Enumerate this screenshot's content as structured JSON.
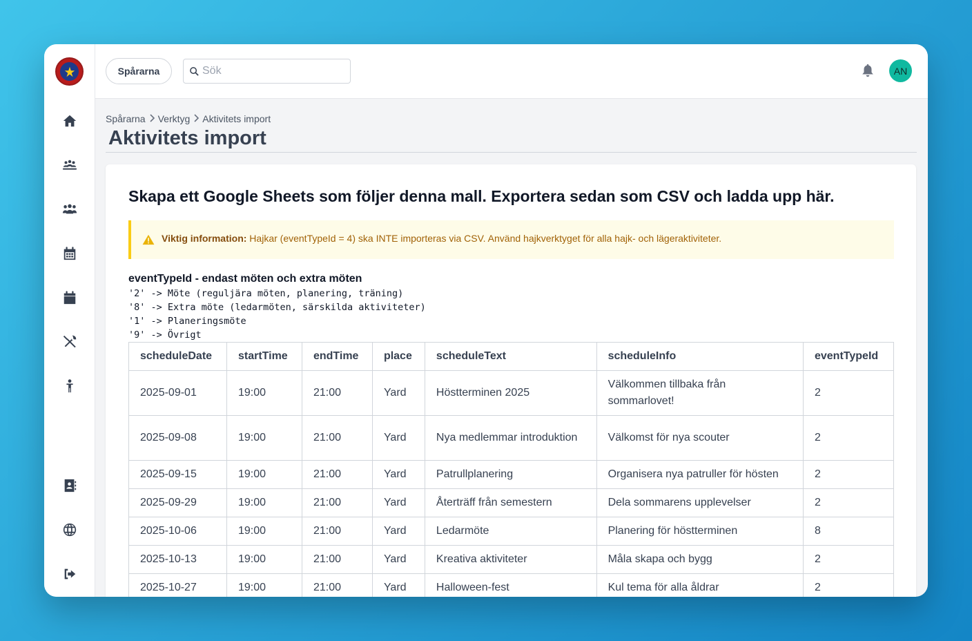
{
  "app": {
    "org_button_label": "Spårarna",
    "search_placeholder": "Sök",
    "avatar_initials": "AN",
    "colors": {
      "avatar": "#10b9a0",
      "notice_border": "#facc15",
      "notice_bg": "#fefce8"
    }
  },
  "sidebar": {
    "top_items": [
      {
        "icon": "home-icon"
      },
      {
        "icon": "group-meeting-icon"
      },
      {
        "icon": "users-icon"
      },
      {
        "icon": "calendar-grid-icon"
      },
      {
        "icon": "calendar-icon"
      },
      {
        "icon": "tools-icon"
      },
      {
        "icon": "person-icon"
      }
    ],
    "bottom_items": [
      {
        "icon": "contact-card-icon"
      },
      {
        "icon": "globe-icon"
      },
      {
        "icon": "logout-icon"
      }
    ]
  },
  "breadcrumb": [
    "Spårarna",
    "Verktyg",
    "Aktivitets import"
  ],
  "page": {
    "title": "Aktivitets import"
  },
  "card": {
    "heading": "Skapa ett Google Sheets som följer denna mall. Exportera sedan som CSV och ladda upp här.",
    "notice": {
      "label": "Viktig information:",
      "text": " Hajkar (eventTypeId = 4) ska INTE importeras via CSV. Använd hajkverktyget för alla hajk- och lägeraktiviteter."
    },
    "event_types_heading": "eventTypeId - endast möten och extra möten",
    "event_types": [
      "'2' -> Möte (reguljära möten, planering, träning)",
      "'8' -> Extra möte (ledarmöten, särskilda aktiviteter)",
      "'1' -> Planeringsmöte",
      "'9' -> Övrigt"
    ]
  },
  "table": {
    "columns": [
      "scheduleDate",
      "startTime",
      "endTime",
      "place",
      "scheduleText",
      "scheduleInfo",
      "eventTypeId"
    ],
    "rows": [
      [
        "2025-09-01",
        "19:00",
        "21:00",
        "Yard",
        "Höstterminen 2025",
        "Välkommen tillbaka från sommarlovet!",
        "2"
      ],
      [
        "2025-09-08",
        "19:00",
        "21:00",
        "Yard",
        "Nya medlemmar introduktion",
        "Välkomst för nya scouter",
        "2"
      ],
      [
        "2025-09-15",
        "19:00",
        "21:00",
        "Yard",
        "Patrullplanering",
        "Organisera nya patruller för hösten",
        "2"
      ],
      [
        "2025-09-29",
        "19:00",
        "21:00",
        "Yard",
        "Återträff från semestern",
        "Dela sommarens upplevelser",
        "2"
      ],
      [
        "2025-10-06",
        "19:00",
        "21:00",
        "Yard",
        "Ledarmöte",
        "Planering för höstterminen",
        "8"
      ],
      [
        "2025-10-13",
        "19:00",
        "21:00",
        "Yard",
        "Kreativa aktiviteter",
        "Måla skapa och bygg",
        "2"
      ],
      [
        "2025-10-27",
        "19:00",
        "21:00",
        "Yard",
        "Halloween-fest",
        "Kul tema för alla åldrar",
        "2"
      ]
    ]
  }
}
